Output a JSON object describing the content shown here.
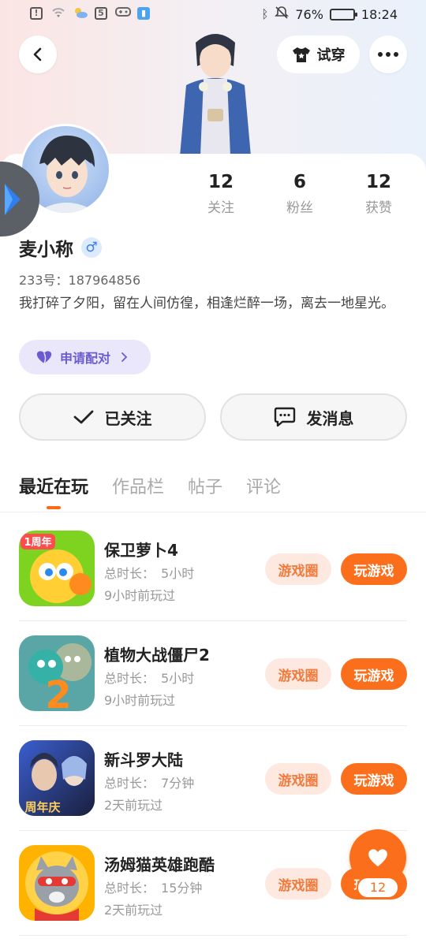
{
  "status_bar": {
    "battery": "76%",
    "battery_level": 0.76,
    "time": "18:24"
  },
  "header": {
    "tryon_label": "试穿"
  },
  "profile": {
    "stats": [
      {
        "num": "12",
        "label": "关注"
      },
      {
        "num": "6",
        "label": "粉丝"
      },
      {
        "num": "12",
        "label": "获赞"
      }
    ],
    "name": "麦小称",
    "gender_symbol": "♂",
    "uid": "233号：187964856",
    "bio": "我打碎了夕阳，留在人间仿徨，相逢烂醉一场，离去一地星光。",
    "match_label": "申请配对"
  },
  "actions": {
    "follow_label": "已关注",
    "message_label": "发消息"
  },
  "tabs": [
    {
      "label": "最近在玩",
      "active": true
    },
    {
      "label": "作品栏",
      "active": false
    },
    {
      "label": "帖子",
      "active": false
    },
    {
      "label": "评论",
      "active": false
    }
  ],
  "games": [
    {
      "title": "保卫萝卜4",
      "duration_label": "总时长：",
      "duration": "5小时",
      "last_played": "9小时前玩过",
      "circle_label": "游戏圈",
      "play_label": "玩游戏"
    },
    {
      "title": "植物大战僵尸2",
      "duration_label": "总时长：",
      "duration": "5小时",
      "last_played": "9小时前玩过",
      "circle_label": "游戏圈",
      "play_label": "玩游戏"
    },
    {
      "title": "新斗罗大陆",
      "duration_label": "总时长：",
      "duration": "7分钟",
      "last_played": "2天前玩过",
      "circle_label": "游戏圈",
      "play_label": "玩游戏"
    },
    {
      "title": "汤姆猫英雄跑酷",
      "duration_label": "总时长：",
      "duration": "15分钟",
      "last_played": "2天前玩过",
      "circle_label": "游戏圈",
      "play_label": "玩游戏"
    }
  ],
  "game_icon_text": [
    "1周年",
    "2",
    "周年庆"
  ],
  "like": {
    "count": "12"
  },
  "colors": {
    "accent": "#fb6f1c",
    "accent_soft": "#fde9df",
    "match_purple": "#6b5bd1",
    "gender_blue": "#3b7de8"
  }
}
